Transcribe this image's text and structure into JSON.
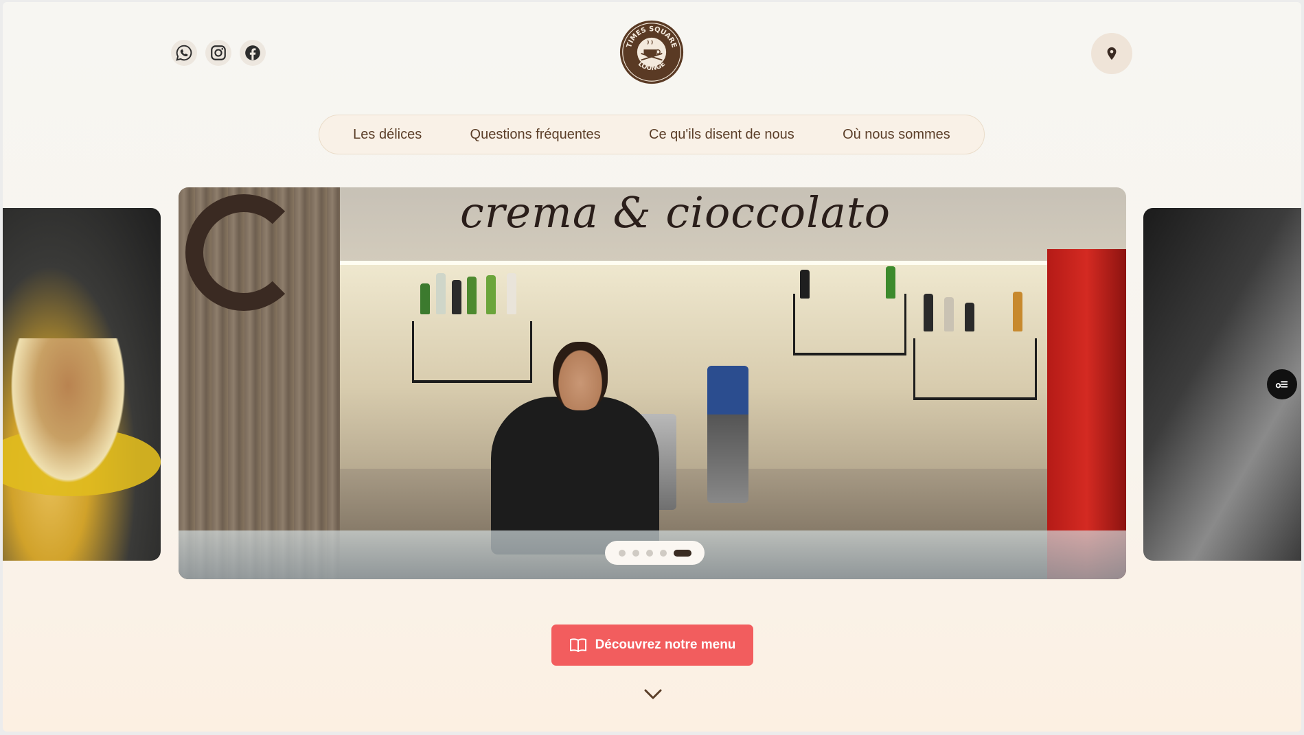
{
  "brand": {
    "logo_text_top": "TIMES SQUARE",
    "logo_text_bottom": "LOUNGE"
  },
  "socials": [
    {
      "icon": "whatsapp-icon"
    },
    {
      "icon": "instagram-icon"
    },
    {
      "icon": "facebook-icon"
    }
  ],
  "location": {
    "icon": "location-pin-icon"
  },
  "nav": {
    "items": [
      {
        "label": "Les délices"
      },
      {
        "label": "Questions fréquentes"
      },
      {
        "label": "Ce qu'ils disent de nous"
      },
      {
        "label": "Où nous sommes"
      }
    ]
  },
  "carousel": {
    "main_sign_text": "crema & cioccolato",
    "slide_count": 5,
    "active_index": 4
  },
  "cta": {
    "label": "Découvrez notre menu",
    "icon": "book-open-icon"
  },
  "colors": {
    "accent": "#f25d5e",
    "brand_brown": "#5b3e28",
    "background": "#f8f4ee"
  }
}
